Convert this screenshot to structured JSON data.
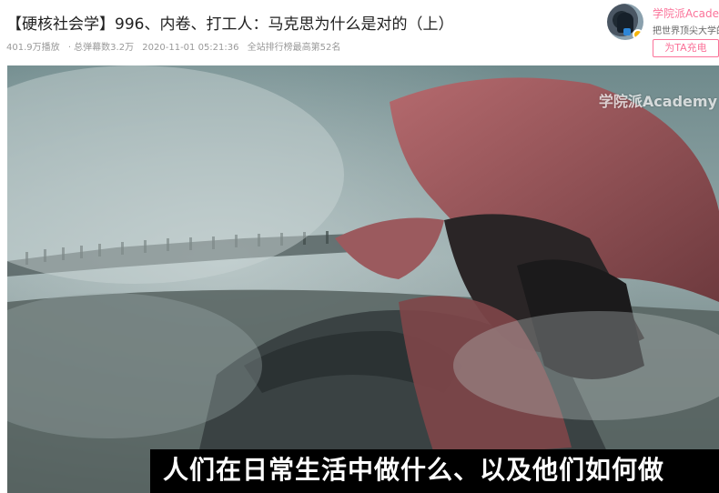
{
  "video": {
    "title": "【硬核社会学】996、内卷、打工人：马克思为什么是对的（上）",
    "plays": "401.9万播放",
    "danmaku": "· 总弹幕数3.2万",
    "date": "2020-11-01 05:21:36",
    "rank": "全站排行榜最高第52名"
  },
  "uploader": {
    "name": "学院派Academy",
    "desc": "把世界顶尖大学的课程带给你",
    "charge_label": "为TA充电"
  },
  "player": {
    "watermark": "学院派Academy",
    "subtitle": "人们在日常生活中做什么、以及他们如何做"
  },
  "colors": {
    "accent": "#fb7299",
    "title_text": "#212121",
    "meta_text": "#999999"
  }
}
